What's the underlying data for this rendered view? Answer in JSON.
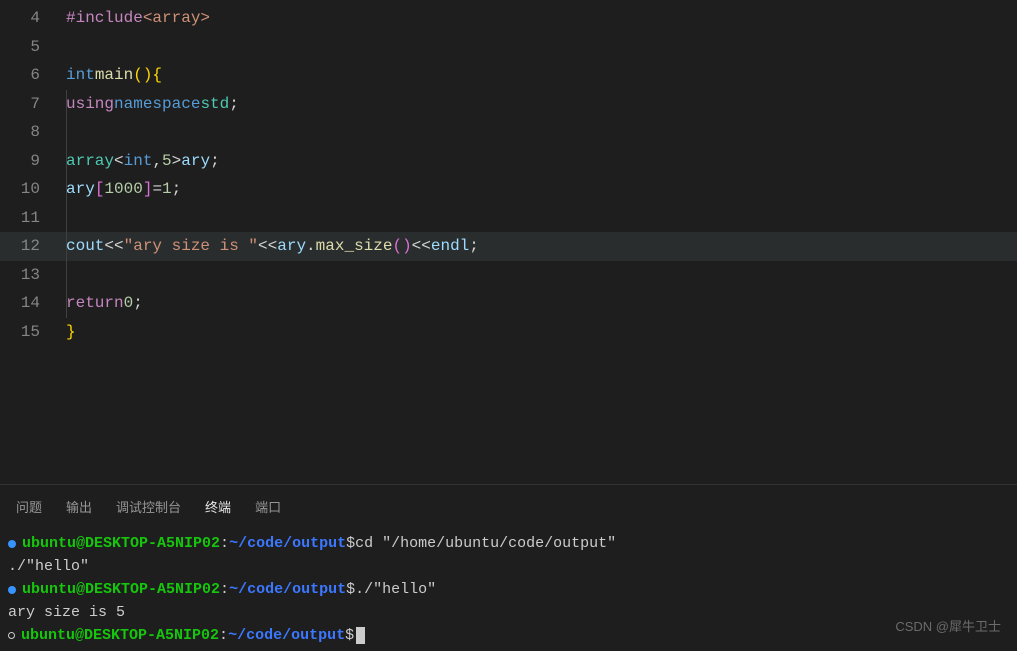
{
  "code": {
    "lines": [
      {
        "n": "4"
      },
      {
        "n": "5"
      },
      {
        "n": "6"
      },
      {
        "n": "7"
      },
      {
        "n": "8"
      },
      {
        "n": "9"
      },
      {
        "n": "10"
      },
      {
        "n": "11"
      },
      {
        "n": "12"
      },
      {
        "n": "13"
      },
      {
        "n": "14"
      },
      {
        "n": "15"
      }
    ],
    "l4_preproc": "#include",
    "l4_path": "<array>",
    "l6_kw1": "int",
    "l6_func": "main",
    "l6_paren": "()",
    "l6_brace": "{",
    "l7_using": "using",
    "l7_ns_kw": "namespace",
    "l7_ns": "std",
    "l7_semi": ";",
    "l9_type": "array",
    "l9_lt": "<",
    "l9_int": "int",
    "l9_comma": ",",
    "l9_num": "5",
    "l9_gt": ">",
    "l9_var": "ary",
    "l9_semi": ";",
    "l10_var": "ary",
    "l10_lbr": "[",
    "l10_idx": "1000",
    "l10_rbr": "]",
    "l10_eq": "=",
    "l10_val": "1",
    "l10_semi": ";",
    "l12_cout": "cout",
    "l12_op1": "<<",
    "l12_str": "\"ary size is \"",
    "l12_op2": "<<",
    "l12_ary": "ary",
    "l12_dot": ".",
    "l12_fn": "max_size",
    "l12_paren": "()",
    "l12_op3": "<<",
    "l12_endl": "endl",
    "l12_semi": ";",
    "l14_ret": "return",
    "l14_val": "0",
    "l14_semi": ";",
    "l15_brace": "}"
  },
  "tabs": {
    "problems": "问题",
    "output": "输出",
    "debug": "调试控制台",
    "terminal": "终端",
    "ports": "端口"
  },
  "terminal": {
    "user": "ubuntu@DESKTOP-A5NIP02",
    "colon": ":",
    "path": "~/code/output",
    "dollar": "$",
    "cmd1": "cd \"/home/ubuntu/code/output\"",
    "out1": "./\"hello\"",
    "cmd2": "./\"hello\"",
    "result": "ary size is 5"
  },
  "watermark": "CSDN @犀牛卫士"
}
